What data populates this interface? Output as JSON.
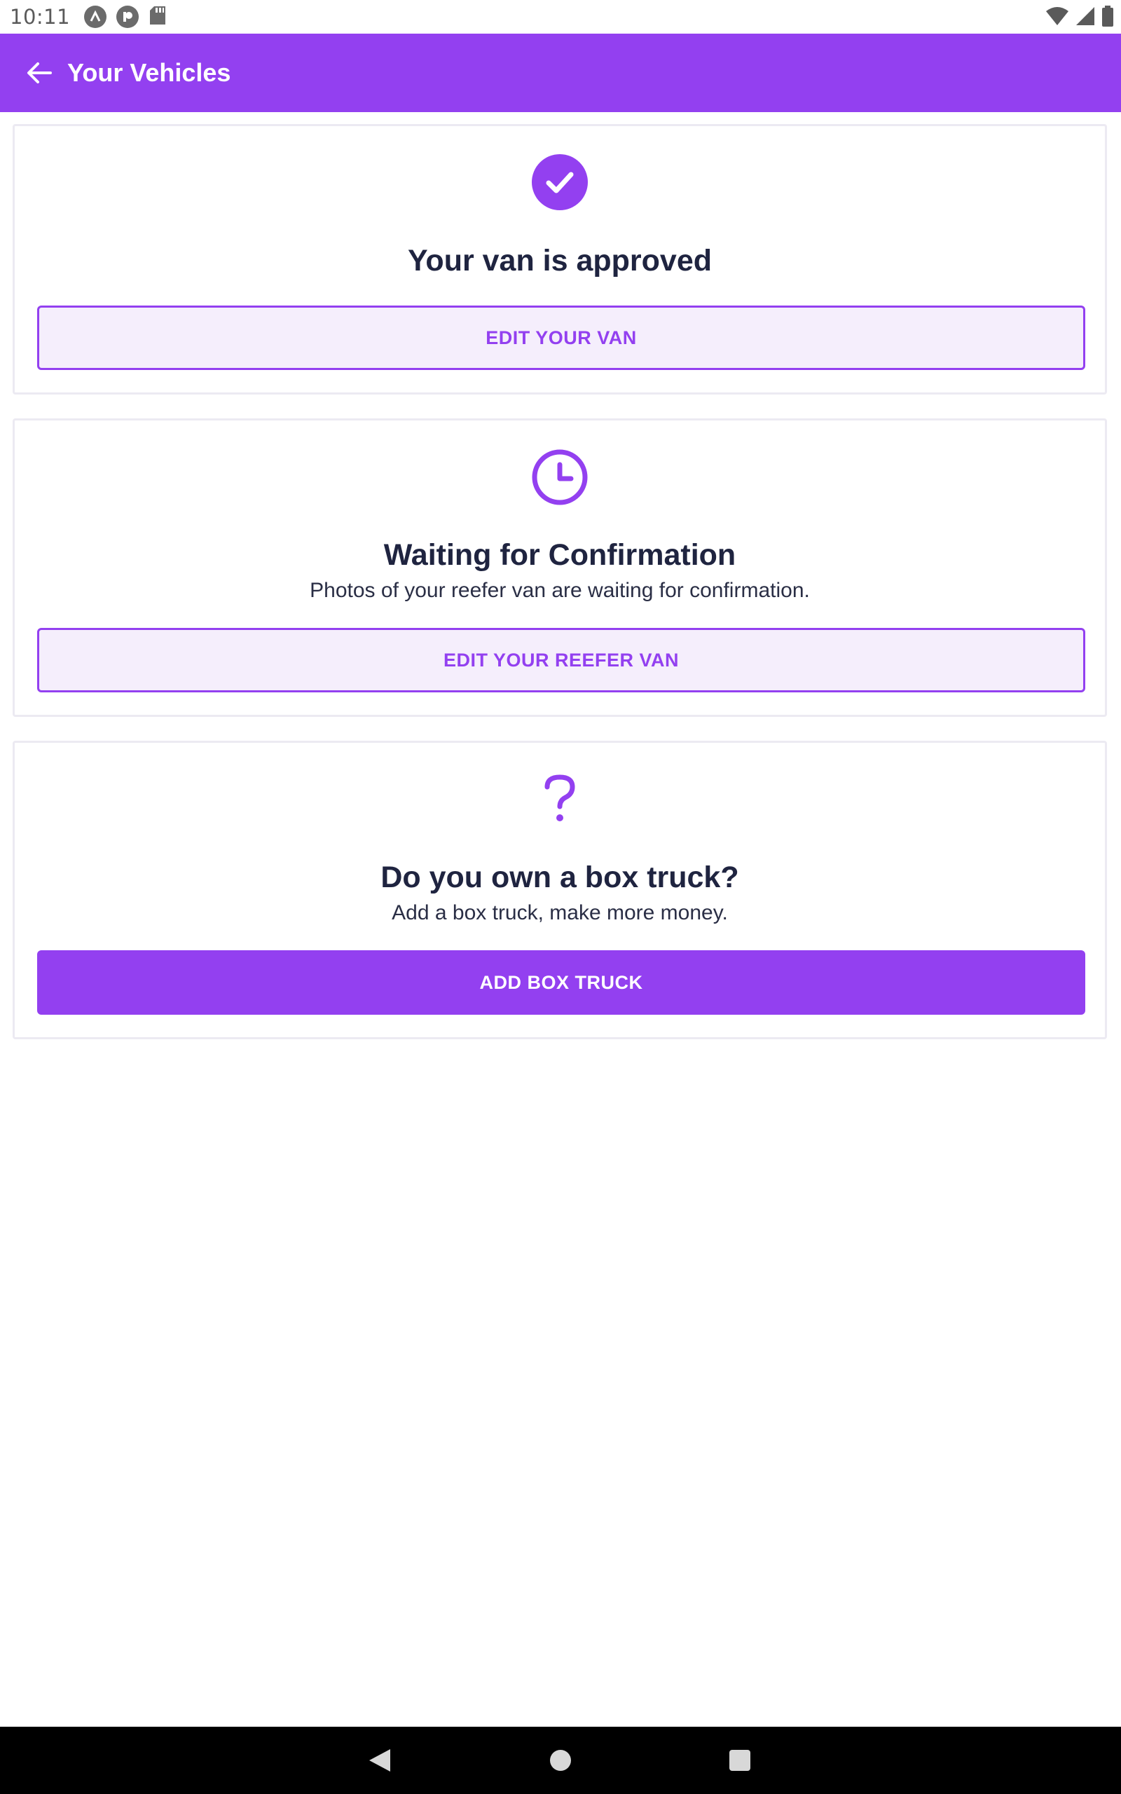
{
  "status_bar": {
    "time": "10:11",
    "left_icons": [
      "app-a-icon",
      "app-p-icon",
      "sd-card-icon"
    ],
    "right_icons": [
      "wifi-icon",
      "signal-icon",
      "battery-icon"
    ]
  },
  "app_bar": {
    "title": "Your Vehicles",
    "back_icon": "arrow-left-icon",
    "background": "#9340f0"
  },
  "cards": [
    {
      "icon": "check-circle-icon",
      "title": "Your van is approved",
      "subtitle": "",
      "button_label": "EDIT YOUR VAN",
      "button_style": "outline"
    },
    {
      "icon": "clock-icon",
      "title": "Waiting for Confirmation",
      "subtitle": "Photos of your reefer van are waiting for confirmation.",
      "button_label": "EDIT YOUR REEFER VAN",
      "button_style": "outline"
    },
    {
      "icon": "question-mark-icon",
      "title": "Do you own a box truck?",
      "subtitle": "Add a box truck, make more money.",
      "button_label": "ADD BOX TRUCK",
      "button_style": "filled"
    }
  ],
  "nav_bar": {
    "items": [
      "back-triangle-icon",
      "home-circle-icon",
      "recents-square-icon"
    ]
  },
  "colors": {
    "accent": "#9340f0",
    "accent_light": "#f5eefc",
    "text_dark": "#1f2440"
  }
}
